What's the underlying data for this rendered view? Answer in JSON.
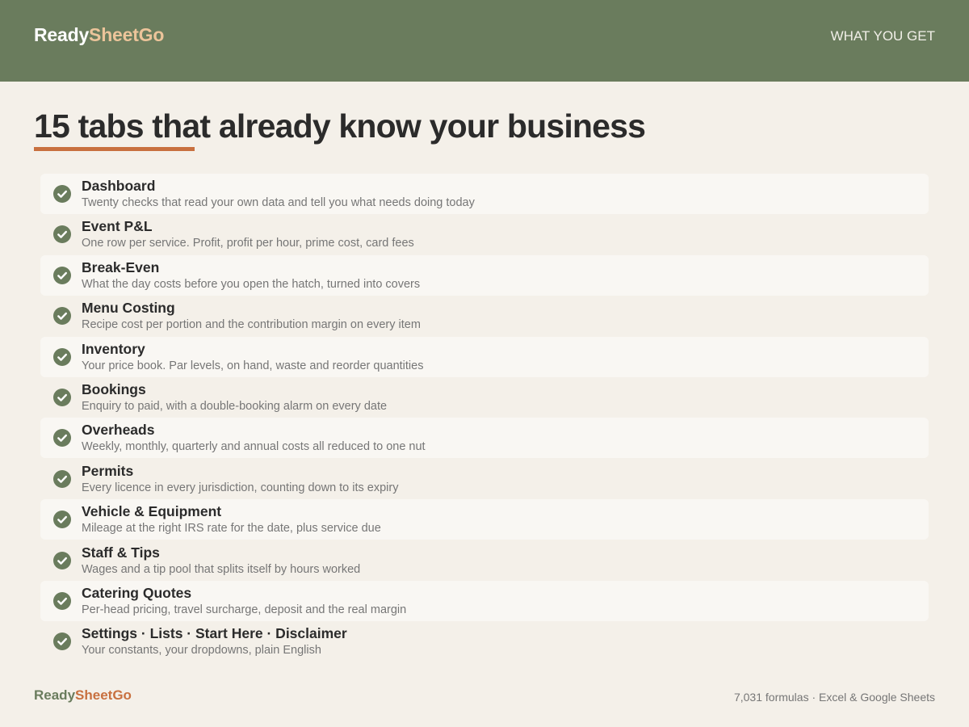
{
  "header": {
    "brand_part1": "Ready",
    "brand_part2": "SheetGo",
    "nav_label": "WHAT YOU GET",
    "bg_color": "#6a7c5d"
  },
  "main": {
    "title": "15 tabs that already know your business",
    "accent_color": "#c8703f",
    "features": [
      {
        "title": "Dashboard",
        "description": "Twenty checks that read your own data and tell you what needs doing today",
        "icon": "check-circle-icon"
      },
      {
        "title": "Event P&L",
        "description": "One row per service. Profit, profit per hour, prime cost, card fees",
        "icon": "check-circle-icon"
      },
      {
        "title": "Break-Even",
        "description": "What the day costs before you open the hatch, turned into covers",
        "icon": "check-circle-icon"
      },
      {
        "title": "Menu Costing",
        "description": "Recipe cost per portion and the contribution margin on every item",
        "icon": "check-circle-icon"
      },
      {
        "title": "Inventory",
        "description": "Your price book. Par levels, on hand, waste and reorder quantities",
        "icon": "check-circle-icon"
      },
      {
        "title": "Bookings",
        "description": "Enquiry to paid, with a double-booking alarm on every date",
        "icon": "check-circle-icon"
      },
      {
        "title": "Overheads",
        "description": "Weekly, monthly, quarterly and annual costs all reduced to one nut",
        "icon": "check-circle-icon"
      },
      {
        "title": "Permits",
        "description": "Every licence in every jurisdiction, counting down to its expiry",
        "icon": "check-circle-icon"
      },
      {
        "title": "Vehicle & Equipment",
        "description": "Mileage at the right IRS rate for the date, plus service due",
        "icon": "check-circle-icon"
      },
      {
        "title": "Staff & Tips",
        "description": "Wages and a tip pool that splits itself by hours worked",
        "icon": "check-circle-icon"
      },
      {
        "title": "Catering Quotes",
        "description": "Per-head pricing, travel surcharge, deposit and the real margin",
        "icon": "check-circle-icon"
      },
      {
        "title": "Settings · Lists · Start Here · Disclaimer",
        "description": "Your constants, your dropdowns, plain English",
        "icon": "check-circle-icon"
      }
    ]
  },
  "footer": {
    "brand_part1": "Ready",
    "brand_part2": "SheetGo",
    "meta": "7,031 formulas · Excel & Google Sheets"
  }
}
